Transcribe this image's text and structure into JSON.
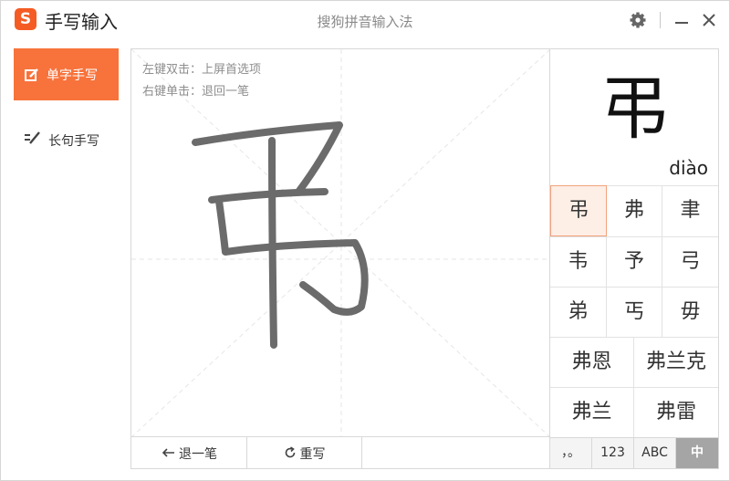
{
  "app": {
    "logo_letter": "S",
    "title": "手写输入",
    "window_title": "搜狗拼音输入法"
  },
  "titlebar_icons": [
    "gear-icon",
    "minimize-icon",
    "close-icon"
  ],
  "sidebar": {
    "items": [
      {
        "label": "单字手写",
        "icon": "pen-square-icon",
        "active": true
      },
      {
        "label": "长句手写",
        "icon": "pen-lines-icon",
        "active": false
      }
    ]
  },
  "canvas": {
    "hints": [
      "左键双击：上屏首选项",
      "右键单击：退回一笔"
    ]
  },
  "toolbar": {
    "undo_label": "退一笔",
    "rewrite_label": "重写"
  },
  "preview": {
    "char": "弔",
    "pinyin": "diào"
  },
  "candidates": [
    [
      "弔",
      "弗",
      "聿"
    ],
    [
      "韦",
      "予",
      "弓"
    ],
    [
      "弟",
      "丐",
      "毋"
    ],
    [
      "弗恩",
      "弗兰克"
    ],
    [
      "弗兰",
      "弗雷"
    ]
  ],
  "modes": [
    {
      "label": "，。",
      "active": false
    },
    {
      "label": "123",
      "active": false
    },
    {
      "label": "ABC",
      "active": false
    },
    {
      "label": "中",
      "active": true
    }
  ],
  "colors": {
    "accent": "#f7733b",
    "logo": "#f45c24",
    "stroke": "#6b6b6b",
    "selected_bg": "#fdeee6"
  }
}
